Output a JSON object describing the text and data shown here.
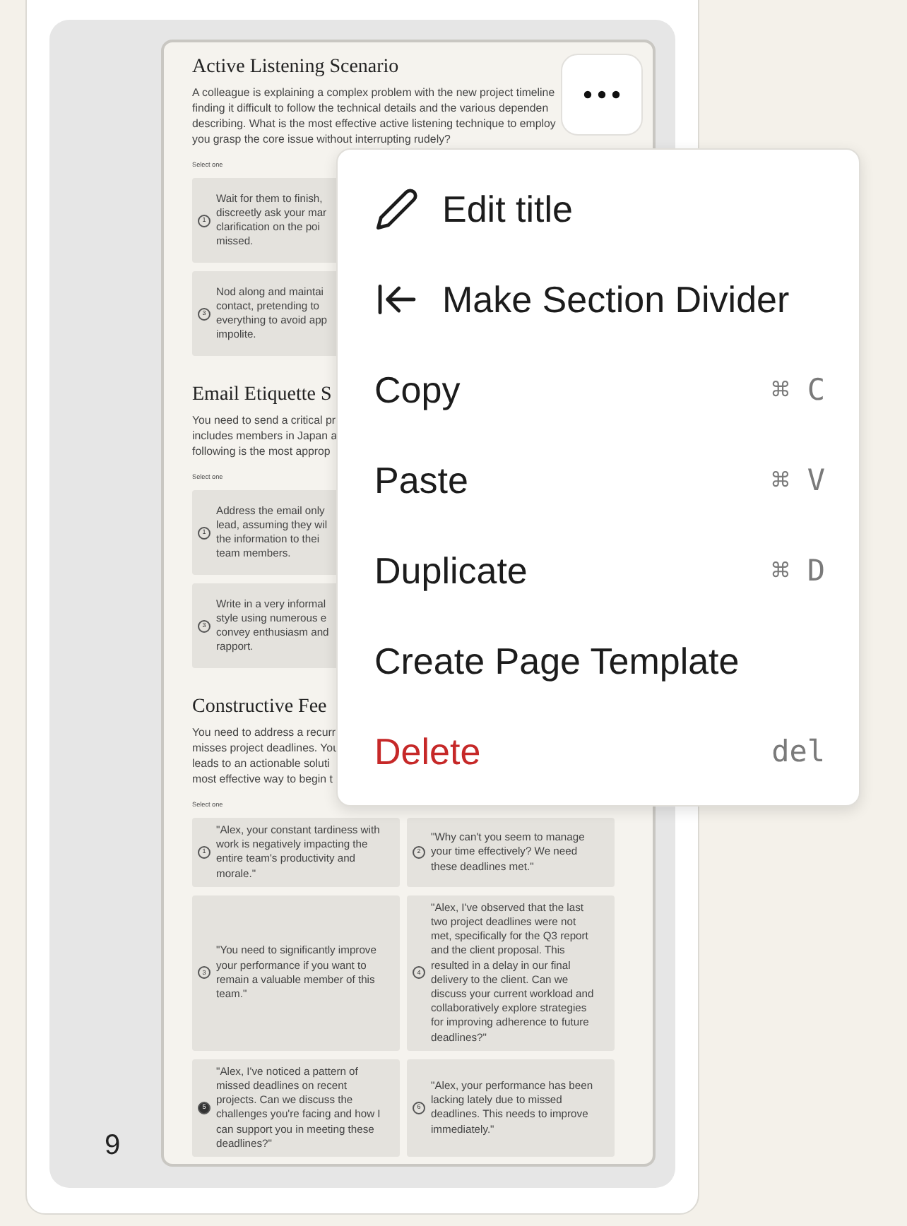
{
  "page_number": "9",
  "page": {
    "sections": [
      {
        "title": "Active Listening Scenario",
        "kind": "narrow",
        "description": [
          "A colleague is explaining a complex problem with the new project timeline",
          "finding it difficult to follow the technical details and the various dependen",
          "describing. What is the most effective active listening technique to employ",
          "you grasp the core issue without interrupting rudely?"
        ],
        "prompt": "Select one",
        "options": [
          {
            "number": "1",
            "lines": [
              "Wait for them to finish,",
              "discreetly ask your mar",
              "clarification on the poi",
              "missed."
            ],
            "selected": false
          },
          {
            "number": "3",
            "lines": [
              "Nod along and maintai",
              "contact, pretending to",
              "everything to avoid app",
              "impolite."
            ],
            "selected": false
          }
        ]
      },
      {
        "title": "Email Etiquette S",
        "kind": "narrow",
        "description": [
          "You need to send a critical pr",
          "includes members in Japan a",
          "following is the most approp"
        ],
        "prompt": "Select one",
        "options": [
          {
            "number": "1",
            "lines": [
              "Address the email only",
              "lead, assuming they wil",
              "the information to thei",
              "team members."
            ],
            "selected": false
          },
          {
            "number": "3",
            "lines": [
              "Write in a very informal",
              "style using numerous e",
              "convey enthusiasm and",
              "rapport."
            ],
            "selected": false
          }
        ]
      },
      {
        "title": "Constructive Fee",
        "kind": "wide",
        "description": [
          "You need to address a recurr",
          "misses project deadlines. You",
          "leads to an actionable soluti",
          "most effective way to begin t"
        ],
        "prompt": "Select one",
        "options": [
          {
            "number": "1",
            "lines": [
              "\"Alex, your constant tardiness with",
              "work is negatively impacting the",
              "entire team's productivity and",
              "morale.\""
            ],
            "selected": false
          },
          {
            "number": "2",
            "lines": [
              "\"Why can't you seem to manage",
              "your time effectively? We need",
              "these deadlines met.\""
            ],
            "selected": false
          },
          {
            "number": "3",
            "lines": [
              "\"You need to significantly improve",
              "your performance if you want to",
              "remain a valuable member of this",
              "team.\""
            ],
            "selected": false
          },
          {
            "number": "4",
            "lines": [
              "\"Alex, I've observed that the last",
              "two project deadlines were not",
              "met, specifically for the Q3 report",
              "and the client proposal. This",
              "resulted in a delay in our final",
              "delivery to the client. Can we",
              "discuss your current workload and",
              "collaboratively explore strategies",
              "for improving adherence to future",
              "deadlines?\""
            ],
            "selected": false
          },
          {
            "number": "5",
            "lines": [
              "\"Alex, I've noticed a pattern of",
              "missed deadlines on recent",
              "projects. Can we discuss the",
              "challenges you're facing and how I",
              "can support you in meeting these",
              "deadlines?\""
            ],
            "selected": true
          },
          {
            "number": "6",
            "lines": [
              "\"Alex, your performance has been",
              "lacking lately due to missed",
              "deadlines. This needs to improve",
              "immediately.\""
            ],
            "selected": false
          }
        ]
      }
    ]
  },
  "menu": {
    "items": [
      {
        "kind": "icon",
        "label": "Edit title"
      },
      {
        "kind": "icon",
        "label": "Make Section Divider"
      },
      {
        "kind": "shortcut",
        "label": "Copy",
        "shortcut": "⌘ C"
      },
      {
        "kind": "shortcut",
        "label": "Paste",
        "shortcut": "⌘ V"
      },
      {
        "kind": "shortcut",
        "label": "Duplicate",
        "shortcut": "⌘ D"
      },
      {
        "kind": "plain",
        "label": "Create Page Template"
      },
      {
        "kind": "danger",
        "label": "Delete",
        "shortcut": "del"
      }
    ]
  }
}
